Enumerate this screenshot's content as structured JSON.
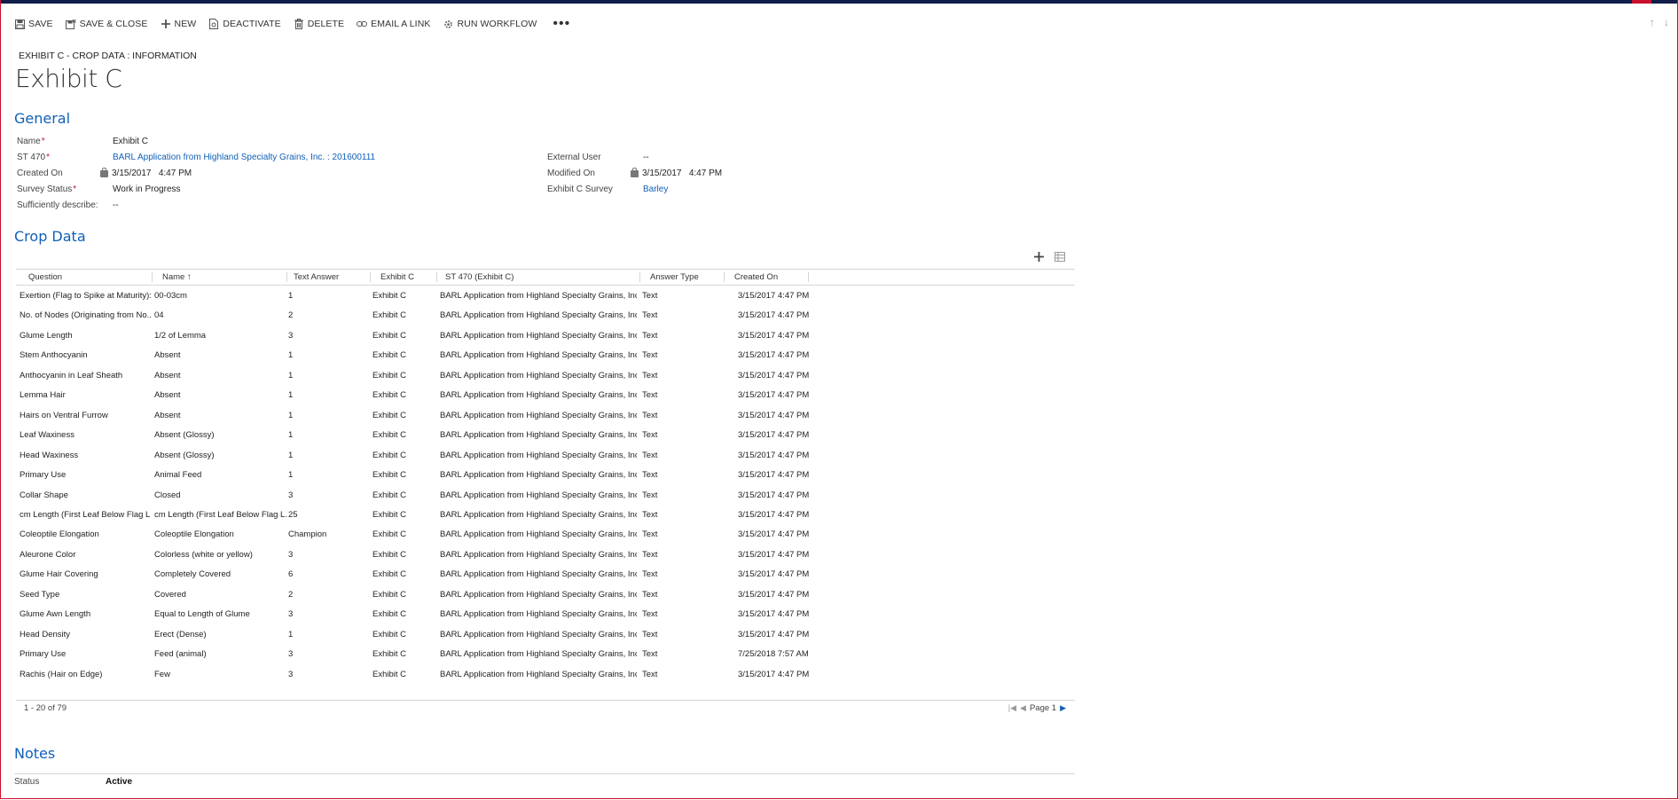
{
  "toolbar": {
    "save": "SAVE",
    "save_close": "SAVE & CLOSE",
    "new": "NEW",
    "deactivate": "DEACTIVATE",
    "delete": "DELETE",
    "email_link": "EMAIL A LINK",
    "run_workflow": "RUN WORKFLOW",
    "more": "•••"
  },
  "breadcrumb": "EXHIBIT C - CROP DATA : INFORMATION",
  "title": "Exhibit C",
  "general": {
    "heading": "General",
    "name_label": "Name",
    "name_value": "Exhibit C",
    "st470_label": "ST 470",
    "st470_value": "BARL Application from Highland Specialty Grains, Inc. : 201600111",
    "created_on_label": "Created On",
    "created_on_value": "3/15/2017   4:47 PM",
    "survey_status_label": "Survey Status",
    "survey_status_value": "Work in Progress",
    "sufficiently_label": "Sufficiently describe:",
    "sufficiently_value": "--",
    "external_user_label": "External User",
    "external_user_value": "--",
    "modified_on_label": "Modified On",
    "modified_on_value": "3/15/2017   4:47 PM",
    "survey_label": "Exhibit C Survey",
    "survey_value": "Barley"
  },
  "crop_data": {
    "heading": "Crop Data",
    "columns": [
      "Question",
      "Name",
      "Text Answer",
      "Exhibit C",
      "ST 470 (Exhibit C)",
      "Answer Type",
      "Created On"
    ],
    "rows": [
      [
        "Exertion (Flag to Spike at Maturity):",
        "00-03cm",
        "1",
        "Exhibit C",
        "BARL Application from Highland Specialty Grains, Inc....",
        "Text",
        "3/15/2017 4:47 PM"
      ],
      [
        "No. of Nodes (Originating from No...",
        "04",
        "2",
        "Exhibit C",
        "BARL Application from Highland Specialty Grains, Inc....",
        "Text",
        "3/15/2017 4:47 PM"
      ],
      [
        "Glume Length",
        "1/2 of Lemma",
        "3",
        "Exhibit C",
        "BARL Application from Highland Specialty Grains, Inc....",
        "Text",
        "3/15/2017 4:47 PM"
      ],
      [
        "Stem Anthocyanin",
        "Absent",
        "1",
        "Exhibit C",
        "BARL Application from Highland Specialty Grains, Inc....",
        "Text",
        "3/15/2017 4:47 PM"
      ],
      [
        "Anthocyanin in Leaf Sheath",
        "Absent",
        "1",
        "Exhibit C",
        "BARL Application from Highland Specialty Grains, Inc....",
        "Text",
        "3/15/2017 4:47 PM"
      ],
      [
        "Lemma Hair",
        "Absent",
        "1",
        "Exhibit C",
        "BARL Application from Highland Specialty Grains, Inc....",
        "Text",
        "3/15/2017 4:47 PM"
      ],
      [
        "Hairs on Ventral Furrow",
        "Absent",
        "1",
        "Exhibit C",
        "BARL Application from Highland Specialty Grains, Inc....",
        "Text",
        "3/15/2017 4:47 PM"
      ],
      [
        "Leaf Waxiness",
        "Absent (Glossy)",
        "1",
        "Exhibit C",
        "BARL Application from Highland Specialty Grains, Inc....",
        "Text",
        "3/15/2017 4:47 PM"
      ],
      [
        "Head Waxiness",
        "Absent (Glossy)",
        "1",
        "Exhibit C",
        "BARL Application from Highland Specialty Grains, Inc....",
        "Text",
        "3/15/2017 4:47 PM"
      ],
      [
        "Primary Use",
        "Animal Feed",
        "1",
        "Exhibit C",
        "BARL Application from Highland Specialty Grains, Inc....",
        "Text",
        "3/15/2017 4:47 PM"
      ],
      [
        "Collar Shape",
        "Closed",
        "3",
        "Exhibit C",
        "BARL Application from Highland Specialty Grains, Inc....",
        "Text",
        "3/15/2017 4:47 PM"
      ],
      [
        "cm Length (First Leaf Below Flag L...",
        "cm Length (First Leaf Below Flag L...",
        "25",
        "Exhibit C",
        "BARL Application from Highland Specialty Grains, Inc....",
        "Text",
        "3/15/2017 4:47 PM"
      ],
      [
        "Coleoptile Elongation",
        "Coleoptile Elongation",
        "Champion",
        "Exhibit C",
        "BARL Application from Highland Specialty Grains, Inc....",
        "Text",
        "3/15/2017 4:47 PM"
      ],
      [
        "Aleurone Color",
        "Colorless (white or yellow)",
        "3",
        "Exhibit C",
        "BARL Application from Highland Specialty Grains, Inc....",
        "Text",
        "3/15/2017 4:47 PM"
      ],
      [
        "Glume Hair Covering",
        "Completely Covered",
        "6",
        "Exhibit C",
        "BARL Application from Highland Specialty Grains, Inc....",
        "Text",
        "3/15/2017 4:47 PM"
      ],
      [
        "Seed Type",
        "Covered",
        "2",
        "Exhibit C",
        "BARL Application from Highland Specialty Grains, Inc....",
        "Text",
        "3/15/2017 4:47 PM"
      ],
      [
        "Glume Awn Length",
        "Equal to Length of Glume",
        "3",
        "Exhibit C",
        "BARL Application from Highland Specialty Grains, Inc....",
        "Text",
        "3/15/2017 4:47 PM"
      ],
      [
        "Head Density",
        "Erect (Dense)",
        "1",
        "Exhibit C",
        "BARL Application from Highland Specialty Grains, Inc....",
        "Text",
        "3/15/2017 4:47 PM"
      ],
      [
        "Primary Use",
        "Feed (animal)",
        "3",
        "Exhibit C",
        "BARL Application from Highland Specialty Grains, Inc....",
        "Text",
        "7/25/2018 7:57 AM"
      ],
      [
        "Rachis (Hair on Edge)",
        "Few",
        "3",
        "Exhibit C",
        "BARL Application from Highland Specialty Grains, Inc....",
        "Text",
        "3/15/2017 4:47 PM"
      ]
    ],
    "record_count": "1 - 20 of 79",
    "page_label": "Page 1"
  },
  "notes": {
    "heading": "Notes",
    "status_label": "Status",
    "status_value": "Active"
  },
  "colors": {
    "accent": "#1160b7",
    "required": "#c8102e",
    "top_bar": "#101e4a"
  }
}
